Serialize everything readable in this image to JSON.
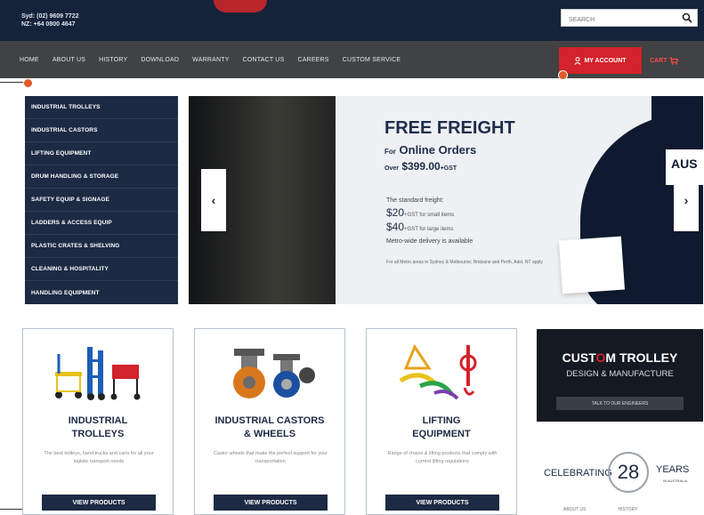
{
  "header": {
    "phone_line_1": "Syd: (02) 9609 7722",
    "phone_line_2": "NZ: +64 0800 4647",
    "search_placeholder": "SEARCH"
  },
  "nav": {
    "items": [
      {
        "label": "HOME"
      },
      {
        "label": "ABOUT US"
      },
      {
        "label": "HISTORY"
      },
      {
        "label": "DOWNLOAD"
      },
      {
        "label": "WARRANTY"
      },
      {
        "label": "CONTACT US"
      },
      {
        "label": "CAREERS"
      },
      {
        "label": "CUSTOM SERVICE"
      }
    ],
    "account_label": "MY ACCOUNT",
    "cart_label": "CART"
  },
  "sidebar": {
    "items": [
      {
        "label": "INDUSTRIAL TROLLEYS"
      },
      {
        "label": "INDUSTRIAL CASTORS"
      },
      {
        "label": "LIFTING EQUIPMENT"
      },
      {
        "label": "DRUM HANDLING & STORAGE"
      },
      {
        "label": "SAFETY EQUIP & SIGNAGE"
      },
      {
        "label": "LADDERS & ACCESS EQUIP"
      },
      {
        "label": "PLASTIC CRATES & SHELVING"
      },
      {
        "label": "CLEANING & HOSPITALITY"
      },
      {
        "label": "HANDLING EQUIPMENT"
      }
    ]
  },
  "banner": {
    "title": "FREE FREIGHT",
    "line1_prefix": "For",
    "line1_main": "Online Orders",
    "line2_prefix": "Over",
    "line2_main": "$399.00",
    "line2_suffix": "+GST",
    "standard_freight": "The standard freight:",
    "price1": "$20",
    "price1_note": "+GST for small items",
    "price2": "$40",
    "price2_note": "+GST for large items",
    "metro_note": "Metro-wide delivery is available",
    "fine_print": "For all Metro areas in Sydney & Melbourne; Brisbane and Perth, Adel, NT apply",
    "side_text": "AUS",
    "prev_glyph": "‹",
    "next_glyph": "›"
  },
  "cards": [
    {
      "title_line1": "INDUSTRIAL",
      "title_line2": "TROLLEYS",
      "desc": "The best trolleys, hand trucks and carts for all your logistic transport needs",
      "button": "VIEW PRODUCTS"
    },
    {
      "title_line1": "INDUSTRIAL CASTORS",
      "title_line2": "& WHEELS",
      "desc": "Castor wheels that make the perfect support for your transportation",
      "button": "VIEW PRODUCTS"
    },
    {
      "title_line1": "LIFTING",
      "title_line2": "EQUIPMENT",
      "desc": "Range of chains & lifting products that comply with current lifting regulations",
      "button": "VIEW PRODUCTS"
    }
  ],
  "custom_trolley": {
    "title_a": "CUST",
    "title_o": "O",
    "title_b": "M TROLLEY",
    "subtitle": "DESIGN & MANUFACTURE",
    "button": "TALK TO OUR ENGINEERS"
  },
  "celebrating": {
    "left": "CELEBRATING",
    "number": "28",
    "right": "YEARS",
    "sub": "IN AUSTRALIA"
  },
  "footer_links": [
    {
      "label": "ABOUT US"
    },
    {
      "label": "HISTORY"
    }
  ],
  "colors": {
    "navy": "#1c2a44",
    "accent_red": "#d3232b",
    "nav_gray": "#404244"
  }
}
